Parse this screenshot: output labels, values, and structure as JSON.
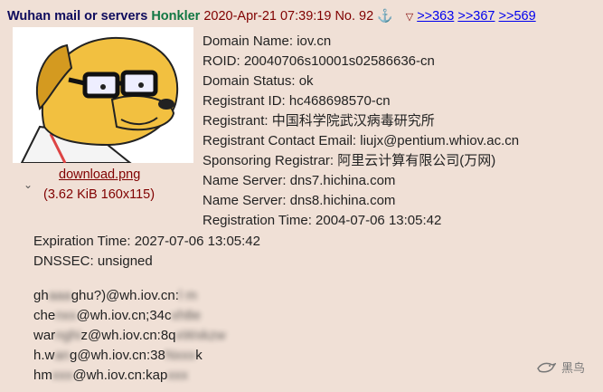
{
  "header": {
    "subject": "Wuhan mail or servers",
    "name": "Honkler",
    "datetime": "2020-Apr-21 07:39:19",
    "post_number": "No. 92",
    "sticky_icon": "anchor-icon",
    "menu_icon": "chevron-down-icon",
    "backlinks": [
      ">>363",
      ">>367",
      ">>569"
    ]
  },
  "file": {
    "name": "download.png",
    "meta": "(3.62 KiB 160x115)",
    "thumbnail_subject": "cartoon dog with glasses"
  },
  "whois_top": [
    "Domain Name: iov.cn",
    "ROID: 20040706s10001s02586636-cn",
    "Domain Status: ok",
    "Registrant ID: hc468698570-cn",
    "Registrant: 中国科学院武汉病毒研究所",
    "Registrant Contact Email: liujx@pentium.whiov.ac.cn",
    "Sponsoring Registrar: 阿里云计算有限公司(万网)",
    "Name Server: dns7.hichina.com",
    "Name Server: dns8.hichina.com",
    "Registration Time: 2004-07-06 13:05:42"
  ],
  "whois_bottom": [
    "Expiration Time: 2027-07-06 13:05:42",
    "DNSSEC: unsigned"
  ],
  "emails": [
    {
      "a": "gh",
      "b": "ghu?)@wh.iov.cn:",
      "c": "l  m"
    },
    {
      "a": "che",
      "b": "@wh.iov.cn;34c",
      "c": ""
    },
    {
      "a": "war",
      "b": "z@wh.iov.cn:8q",
      "c": ""
    },
    {
      "a": "h.w",
      "b": "g@wh.iov.cn:38",
      "c": "k"
    },
    {
      "a": "hm",
      "b": "@wh.iov.cn:kap",
      "c": ""
    }
  ],
  "watermark": "黑鸟",
  "colors": {
    "background": "#f0e0d6",
    "subject": "#0f0c5d",
    "name": "#117743",
    "text": "#800000",
    "link": "#0000ee"
  }
}
